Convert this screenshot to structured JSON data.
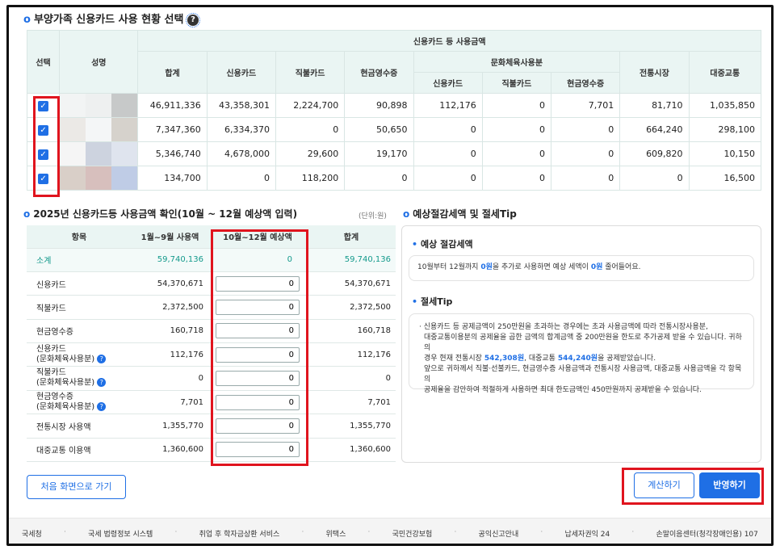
{
  "section1": {
    "title": "부양가족 신용카드 사용 현황 선택",
    "help_icon": "?",
    "headers": {
      "select": "선택",
      "name": "성명",
      "group": "신용카드 등 사용금액",
      "total": "합계",
      "credit": "신용카드",
      "debit": "직불카드",
      "cash": "현금영수증",
      "culture_group": "문화체육사용분",
      "culture_credit": "신용카드",
      "culture_debit": "직불카드",
      "culture_cash": "현금영수증",
      "market": "전통시장",
      "transit": "대중교통"
    },
    "rows": [
      {
        "checked": "✓",
        "total": "46,911,336",
        "credit": "43,358,301",
        "debit": "2,224,700",
        "cash": "90,898",
        "c_credit": "112,176",
        "c_debit": "0",
        "c_cash": "7,701",
        "market": "81,710",
        "transit": "1,035,850"
      },
      {
        "checked": "✓",
        "total": "7,347,360",
        "credit": "6,334,370",
        "debit": "0",
        "cash": "50,650",
        "c_credit": "0",
        "c_debit": "0",
        "c_cash": "0",
        "market": "664,240",
        "transit": "298,100"
      },
      {
        "checked": "✓",
        "total": "5,346,740",
        "credit": "4,678,000",
        "debit": "29,600",
        "cash": "19,170",
        "c_credit": "0",
        "c_debit": "0",
        "c_cash": "0",
        "market": "609,820",
        "transit": "10,150"
      },
      {
        "checked": "✓",
        "total": "134,700",
        "credit": "0",
        "debit": "118,200",
        "cash": "0",
        "c_credit": "0",
        "c_debit": "0",
        "c_cash": "0",
        "market": "0",
        "transit": "16,500"
      }
    ]
  },
  "section2": {
    "title": "2025년 신용카드등 사용금액 확인(10월 ~ 12월 예상액 입력)",
    "unit": "(단위:원)",
    "headers": {
      "item": "항목",
      "jan_sep": "1월~9월 사용액",
      "oct_dec": "10월~12월 예상액",
      "sum": "합계"
    },
    "subtotal": {
      "label": "소계",
      "jan_sep": "59,740,136",
      "oct_dec": "0",
      "sum": "59,740,136"
    },
    "rows": [
      {
        "label": "신용카드",
        "label2": "",
        "help": "",
        "jan_sep": "54,370,671",
        "oct_dec": "0",
        "sum": "54,370,671"
      },
      {
        "label": "직불카드",
        "label2": "",
        "help": "",
        "jan_sep": "2,372,500",
        "oct_dec": "0",
        "sum": "2,372,500"
      },
      {
        "label": "현금영수증",
        "label2": "",
        "help": "",
        "jan_sep": "160,718",
        "oct_dec": "0",
        "sum": "160,718"
      },
      {
        "label": "신용카드",
        "label2": "(문화체육사용분)",
        "help": "?",
        "jan_sep": "112,176",
        "oct_dec": "0",
        "sum": "112,176"
      },
      {
        "label": "직불카드",
        "label2": "(문화체육사용분)",
        "help": "?",
        "jan_sep": "0",
        "oct_dec": "0",
        "sum": "0"
      },
      {
        "label": "현금영수증",
        "label2": "(문화체육사용분)",
        "help": "?",
        "jan_sep": "7,701",
        "oct_dec": "0",
        "sum": "7,701"
      },
      {
        "label": "전통시장 사용액",
        "label2": "",
        "help": "",
        "jan_sep": "1,355,770",
        "oct_dec": "0",
        "sum": "1,355,770"
      },
      {
        "label": "대중교통 이용액",
        "label2": "",
        "help": "",
        "jan_sep": "1,360,600",
        "oct_dec": "0",
        "sum": "1,360,600"
      }
    ]
  },
  "section3": {
    "title": "예상절감세액 및 절세Tip",
    "saving_heading": "예상 절감세액",
    "saving_text_a": "10월부터 12월까지 ",
    "saving_amount1": "0원",
    "saving_text_b": "을 추가로 사용하면 예상 세액이 ",
    "saving_amount2": "0원",
    "saving_text_c": " 줄어들어요.",
    "tip_heading": "절세Tip",
    "tip_line1": "· 신용카드 등 공제금액이 250만원을 초과하는 경우에는 초과 사용금액에 따라 전통시장사용분,",
    "tip_line2": "대중교통이용분의 공제율을 곱한 금액의 합계금액 중 200만원을 한도로 추가공제 받을 수 있습니다. 귀하의",
    "tip_line3a": "경우 현재 전통시장 ",
    "tip_market": "542,308원",
    "tip_line3b": ", 대중교통 ",
    "tip_transit": "544,240원",
    "tip_line3c": "을 공제받았습니다.",
    "tip_line4": "앞으로 귀하께서 직불·선불카드, 현금영수증 사용금액과 전통시장 사용금액, 대중교통 사용금액을 각 항목의",
    "tip_line5": "공제율을 감안하여 적절하게 사용하면 최대 한도금액인 450만원까지 공제받을 수 있습니다."
  },
  "buttons": {
    "home": "처음 화면으로 가기",
    "calculate": "계산하기",
    "apply": "반영하기"
  },
  "footer": {
    "links": [
      "국세청",
      "국세 법령정보 시스템",
      "취업 후 학자금상환 서비스",
      "위택스",
      "국민건강보험",
      "공익신고안내",
      "납세자권익 24",
      "손말이음센터(청각장애인용) 107"
    ],
    "separator": "·"
  },
  "colors": {
    "accent": "#1f6fe5",
    "teal": "#149a8c",
    "highlight": "#e0141e",
    "header_bg": "#eaf5f3"
  },
  "icons": [
    "help-icon",
    "checkbox-checked-icon",
    "bullet-icon"
  ]
}
